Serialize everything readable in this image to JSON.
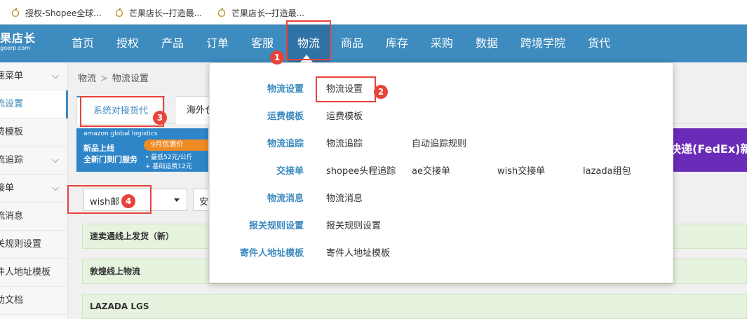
{
  "bookmarks": [
    {
      "label": "授权-Shopee全球..."
    },
    {
      "label": "芒果店长--打造最..."
    },
    {
      "label": "芒果店长--打造最..."
    }
  ],
  "logo": {
    "line1": "果店长",
    "line2": "goerp.com"
  },
  "nav": [
    "首页",
    "授权",
    "产品",
    "订单",
    "客服",
    "物流",
    "商品",
    "库存",
    "采购",
    "数据",
    "跨境学院",
    "货代"
  ],
  "sidebar": [
    {
      "label": "速菜单",
      "chevron": "⌵"
    },
    {
      "label": "流设置",
      "chevron": ""
    },
    {
      "label": "费模板",
      "chevron": ""
    },
    {
      "label": "流追踪",
      "chevron": "⌵"
    },
    {
      "label": "接单",
      "chevron": "⌵"
    },
    {
      "label": "流消息",
      "chevron": ""
    },
    {
      "label": "关规则设置",
      "chevron": ""
    },
    {
      "label": "件人地址模板",
      "chevron": ""
    },
    {
      "label": "助文档",
      "chevron": ""
    }
  ],
  "breadcrumb": {
    "root": "物流",
    "sep": ">",
    "current": "物流设置"
  },
  "tabs": [
    "系统对接货代",
    "海外仓"
  ],
  "banner": {
    "brand": "amazon global logistics",
    "line1": "新品上线",
    "line2": "全新门到门服务",
    "promo": "9月优惠价",
    "price1": "• 最低52元/公斤",
    "price2": "+ 基础运费12元"
  },
  "banner2": {
    "text": "快递(FedEx)新"
  },
  "filters": {
    "carrier": "wish邮",
    "second": "安"
  },
  "groups": [
    "速卖通线上发货（新）",
    "敦煌线上物流",
    "LAZADA LGS"
  ],
  "dropdown": [
    {
      "category": "物流设置",
      "links": [
        "物流设置"
      ]
    },
    {
      "category": "运费模板",
      "links": [
        "运费模板"
      ]
    },
    {
      "category": "物流追踪",
      "links": [
        "物流追踪",
        "自动追踪规则"
      ]
    },
    {
      "category": "交接单",
      "links": [
        "shopee头程追踪",
        "ae交接单",
        "wish交接单",
        "lazada组包"
      ]
    },
    {
      "category": "物流消息",
      "links": [
        "物流消息"
      ]
    },
    {
      "category": "报关规则设置",
      "links": [
        "报关规则设置"
      ]
    },
    {
      "category": "寄件人地址模板",
      "links": [
        "寄件人地址模板"
      ]
    }
  ],
  "annotations": [
    "1",
    "2",
    "3",
    "4"
  ],
  "colors": {
    "nav": "#3d8bbf",
    "nav_active": "#2f73a6",
    "highlight": "#e8433a",
    "group_bg": "#e6f3de"
  }
}
